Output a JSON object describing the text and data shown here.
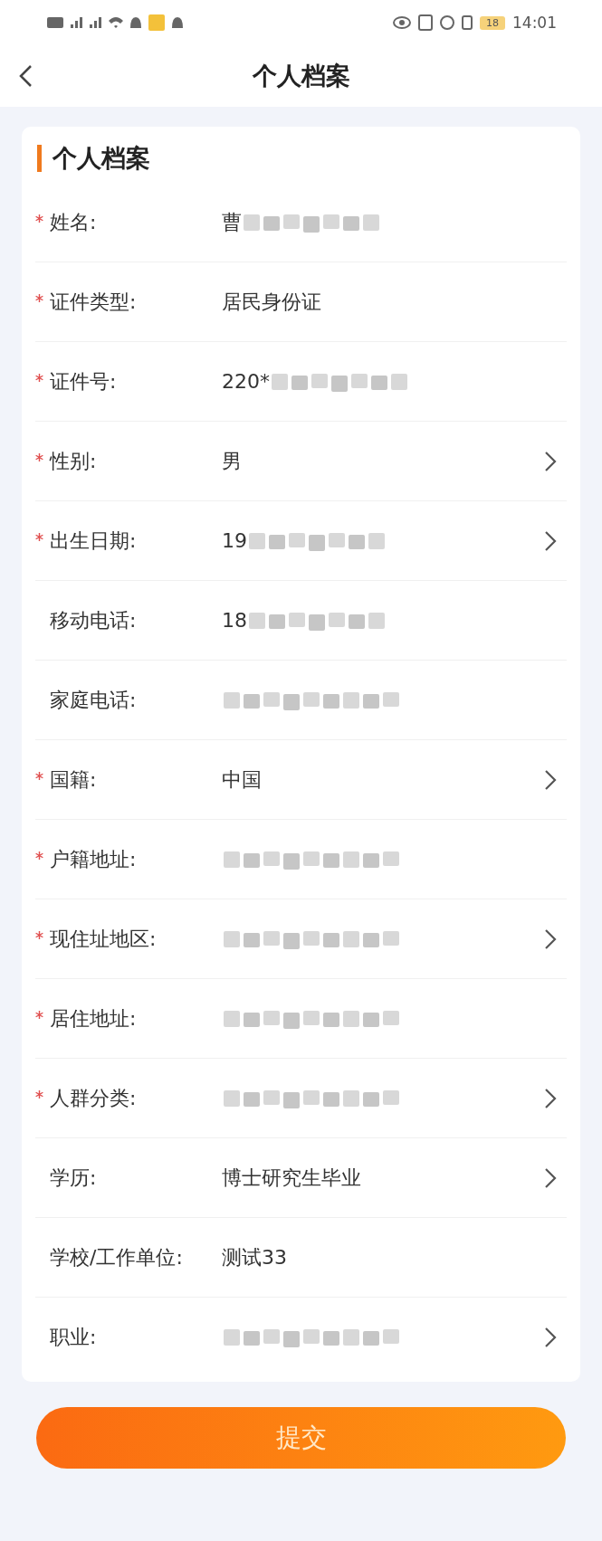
{
  "status_bar": {
    "battery": "18",
    "time": "14:01"
  },
  "nav": {
    "title": "个人档案"
  },
  "card": {
    "title": "个人档案",
    "fields": [
      {
        "label": "姓名:",
        "required": true,
        "value": "曹",
        "blurred": true,
        "chevron": false
      },
      {
        "label": "证件类型:",
        "required": true,
        "value": "居民身份证",
        "blurred": false,
        "chevron": false
      },
      {
        "label": "证件号:",
        "required": true,
        "value": "220*",
        "blurred": true,
        "chevron": false
      },
      {
        "label": "性别:",
        "required": true,
        "value": "男",
        "blurred": false,
        "chevron": true
      },
      {
        "label": "出生日期:",
        "required": true,
        "value": "19",
        "blurred": true,
        "chevron": true
      },
      {
        "label": "移动电话:",
        "required": false,
        "value": "18",
        "blurred": true,
        "chevron": false
      },
      {
        "label": "家庭电话:",
        "required": false,
        "blurred": true,
        "chevron": false
      },
      {
        "label": "国籍:",
        "required": true,
        "value": "中国",
        "blurred": false,
        "chevron": true
      },
      {
        "label": "户籍地址:",
        "required": true,
        "blurred": true,
        "chevron": false
      },
      {
        "label": "现住址地区:",
        "required": true,
        "blurred": true,
        "chevron": true
      },
      {
        "label": "居住地址:",
        "required": true,
        "blurred": true,
        "chevron": false
      },
      {
        "label": "人群分类:",
        "required": true,
        "blurred": true,
        "chevron": true
      },
      {
        "label": "学历:",
        "required": false,
        "value": "博士研究生毕业",
        "blurred": false,
        "chevron": true
      },
      {
        "label": "学校/工作单位:",
        "required": false,
        "value": "测试33",
        "blurred": false,
        "chevron": false
      },
      {
        "label": "职业:",
        "required": false,
        "blurred": true,
        "chevron": true
      }
    ]
  },
  "submit_button": "提交"
}
